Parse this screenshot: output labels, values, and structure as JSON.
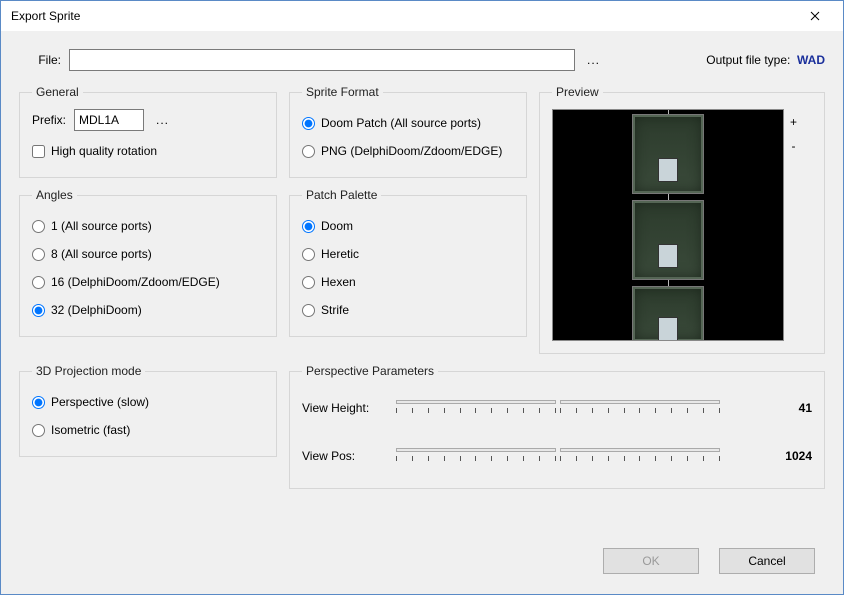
{
  "window": {
    "title": "Export Sprite"
  },
  "file": {
    "label": "File:",
    "value": "",
    "browse": "...",
    "output_label": "Output file type:",
    "output_value": "WAD"
  },
  "general": {
    "legend": "General",
    "prefix_label": "Prefix:",
    "prefix_value": "MDL1A",
    "prefix_browse": "...",
    "hq_label": "High quality rotation",
    "hq_checked": false
  },
  "sprite_format": {
    "legend": "Sprite Format",
    "options": [
      {
        "label": "Doom Patch (All source ports)",
        "checked": true
      },
      {
        "label": "PNG (DelphiDoom/Zdoom/EDGE)",
        "checked": false
      }
    ]
  },
  "angles": {
    "legend": "Angles",
    "options": [
      {
        "label": "1 (All source ports)",
        "checked": false
      },
      {
        "label": "8 (All source ports)",
        "checked": false
      },
      {
        "label": "16 (DelphiDoom/Zdoom/EDGE)",
        "checked": false
      },
      {
        "label": "32 (DelphiDoom)",
        "checked": true
      }
    ]
  },
  "palette": {
    "legend": "Patch Palette",
    "options": [
      {
        "label": "Doom",
        "checked": true
      },
      {
        "label": "Heretic",
        "checked": false
      },
      {
        "label": "Hexen",
        "checked": false
      },
      {
        "label": "Strife",
        "checked": false
      }
    ]
  },
  "preview": {
    "legend": "Preview",
    "zoom_in": "+",
    "zoom_out": "-"
  },
  "projection": {
    "legend": "3D Projection mode",
    "options": [
      {
        "label": "Perspective (slow)",
        "checked": true
      },
      {
        "label": "Isometric (fast)",
        "checked": false
      }
    ]
  },
  "perspective": {
    "legend": "Perspective Parameters",
    "height_label": "View Height:",
    "height_value": "41",
    "pos_label": "View Pos:",
    "pos_value": "1024"
  },
  "buttons": {
    "ok": "OK",
    "cancel": "Cancel"
  }
}
